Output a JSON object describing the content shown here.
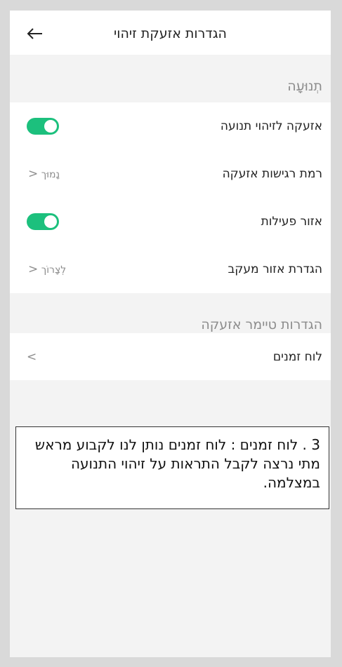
{
  "header": {
    "title": "הגדרות אזעקת זיהוי",
    "back_icon": "arrow-left-icon"
  },
  "section_motion": {
    "title": "תְנוּעָה",
    "rows": [
      {
        "label": "אזעקה לזיהוי תנועה",
        "type": "toggle",
        "on": true
      },
      {
        "label": "רמת רגישות אזעקה",
        "type": "value",
        "value": "נָמוּך",
        "chevron": "<"
      },
      {
        "label": "אזור פעילות",
        "type": "toggle",
        "on": true
      },
      {
        "label": "הגדרת אזור מעקב",
        "type": "value",
        "value": "לְצָרוֹך",
        "chevron": "<"
      }
    ]
  },
  "section_timer": {
    "title": "הגדרות טיימר אזעקה",
    "rows": [
      {
        "label": "לוח זמנים",
        "type": "chevron",
        "chevron": ">"
      }
    ]
  },
  "note": {
    "text": "3 . לוח זמנים : לוח זמנים נותן לנו לקבוע מראש מתי  נרצה לקבל התראות על זיהוי התנועה במצלמה."
  },
  "colors": {
    "toggle_on": "#1cc07d",
    "section_bg": "#f3f3f3",
    "outer_bg": "#d9d9d9"
  }
}
